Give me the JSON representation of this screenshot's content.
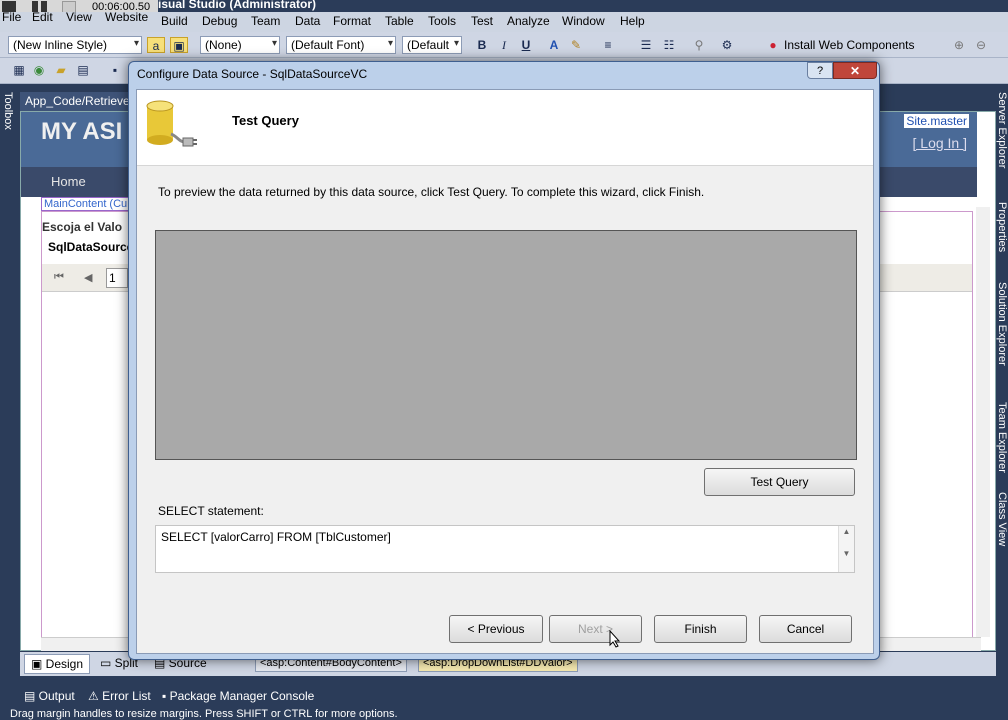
{
  "recorder": {
    "time": "00:06:00.50"
  },
  "ide": {
    "title": "isual Studio (Administrator)",
    "menu": [
      "File",
      "Edit",
      "View",
      "Website",
      "Build",
      "Debug",
      "Team",
      "Data",
      "Format",
      "Table",
      "Tools",
      "Test",
      "Analyze",
      "Window",
      "Help"
    ],
    "toolbar": {
      "style_combo": "(New Inline Style)",
      "block_combo": "(None)",
      "font_combo": "(Default Font)",
      "size_combo": "(Default",
      "install_label": "Install Web Components"
    },
    "toolbox_label": "Toolbox",
    "right_panels": [
      "Server Explorer",
      "Properties",
      "Solution Explorer",
      "Team Explorer",
      "Class View"
    ],
    "doc_tab": "App_Code/Retrieve",
    "designer": {
      "site_title": "MY ASI",
      "site_master": "Site.master",
      "login": "[ Log In ]",
      "nav_home": "Home",
      "maincontent_tag": "MainContent (Cu",
      "escoja": "Escoja el Valo",
      "sqlds": "SqlDataSource",
      "page_value": "1"
    },
    "view_tabs": {
      "design": "Design",
      "split": "Split",
      "source": "Source"
    },
    "breadcrumbs": [
      "<asp:Content#BodyContent>",
      "<asp:DropDownList#DDValor>"
    ],
    "output_tabs": [
      "Output",
      "Error List",
      "Package Manager Console"
    ],
    "status": "Drag margin handles to resize margins. Press SHIFT or CTRL for more options."
  },
  "dialog": {
    "title": "Configure Data Source - SqlDataSourceVC",
    "help": "?",
    "close": "✕",
    "heading": "Test Query",
    "instruction": "To preview the data returned by this data source, click Test Query. To complete this wizard, click Finish.",
    "test_query": "Test Query",
    "select_label": "SELECT statement:",
    "select_sql": "SELECT [valorCarro] FROM [TblCustomer]",
    "previous": "< Previous",
    "next": "Next >",
    "finish": "Finish",
    "cancel": "Cancel"
  }
}
